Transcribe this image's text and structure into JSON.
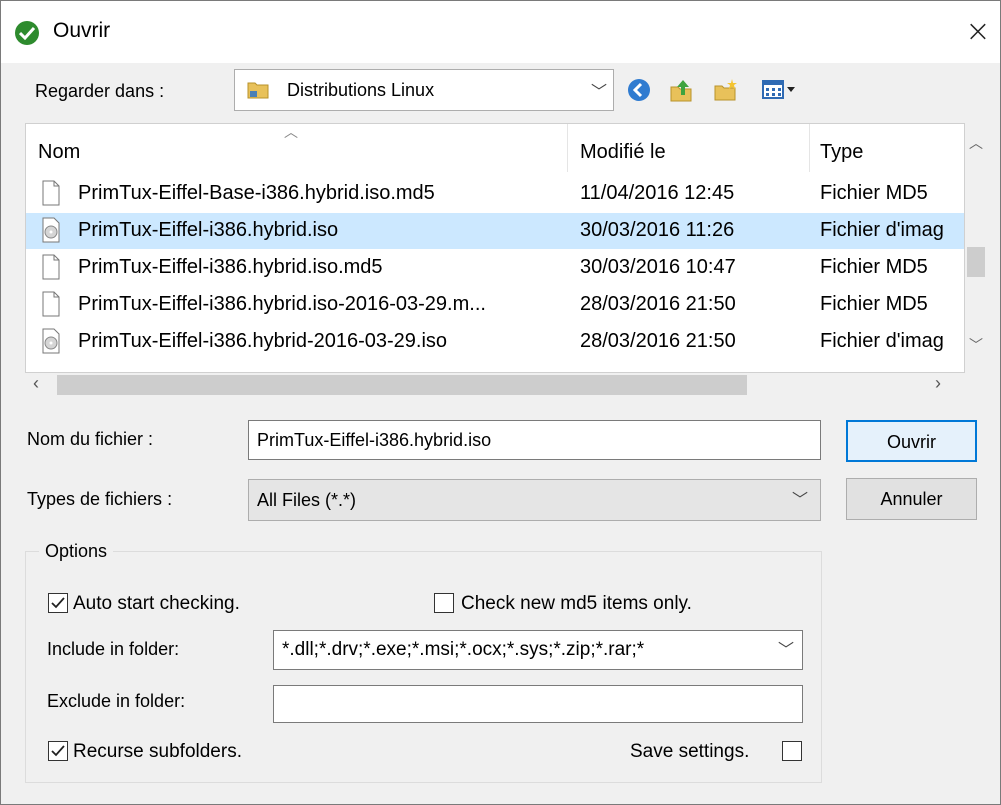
{
  "window": {
    "title": "Ouvrir",
    "close_glyph": "×",
    "icon": "green-check-icon"
  },
  "lookin": {
    "label": "Regarder dans :",
    "value": "Distributions Linux"
  },
  "toolbar_icons": [
    "back-icon",
    "up-folder-icon",
    "new-folder-icon",
    "view-menu-icon"
  ],
  "file_list": {
    "columns": [
      "Nom",
      "Modifié le",
      "Type"
    ],
    "rows": [
      {
        "name": "PrimTux-Eiffel-Base-i386.hybrid.iso.md5",
        "date": "11/04/2016 12:45",
        "type": "Fichier MD5",
        "icon": "document-icon",
        "selected": false
      },
      {
        "name": "PrimTux-Eiffel-i386.hybrid.iso",
        "date": "30/03/2016 11:26",
        "type": "Fichier d'imag",
        "icon": "disc-image-icon",
        "selected": true
      },
      {
        "name": "PrimTux-Eiffel-i386.hybrid.iso.md5",
        "date": "30/03/2016 10:47",
        "type": "Fichier MD5",
        "icon": "document-icon",
        "selected": false
      },
      {
        "name": "PrimTux-Eiffel-i386.hybrid.iso-2016-03-29.m...",
        "date": "28/03/2016 21:50",
        "type": "Fichier MD5",
        "icon": "document-icon",
        "selected": false
      },
      {
        "name": "PrimTux-Eiffel-i386.hybrid-2016-03-29.iso",
        "date": "28/03/2016 21:50",
        "type": "Fichier d'imag",
        "icon": "disc-image-icon",
        "selected": false
      }
    ]
  },
  "filename": {
    "label": "Nom du fichier :",
    "value": "PrimTux-Eiffel-i386.hybrid.iso"
  },
  "filetypes": {
    "label": "Types de fichiers :",
    "value": "All Files (*.*)"
  },
  "buttons": {
    "open": "Ouvrir",
    "cancel": "Annuler"
  },
  "options": {
    "title": "Options",
    "auto_start": {
      "label": "Auto start checking.",
      "checked": true
    },
    "check_new_md5": {
      "label": "Check new md5 items only.",
      "checked": false
    },
    "include_label": "Include in folder:",
    "include_value": "*.dll;*.drv;*.exe;*.msi;*.ocx;*.sys;*.zip;*.rar;*",
    "exclude_label": "Exclude in folder:",
    "exclude_value": "",
    "recurse": {
      "label": "Recurse subfolders.",
      "checked": true
    },
    "save_settings": {
      "label": "Save settings.",
      "checked": false
    }
  },
  "colors": {
    "selection": "#cce8ff",
    "accent": "#0078d7",
    "title_icon": "#2e8b2e"
  }
}
